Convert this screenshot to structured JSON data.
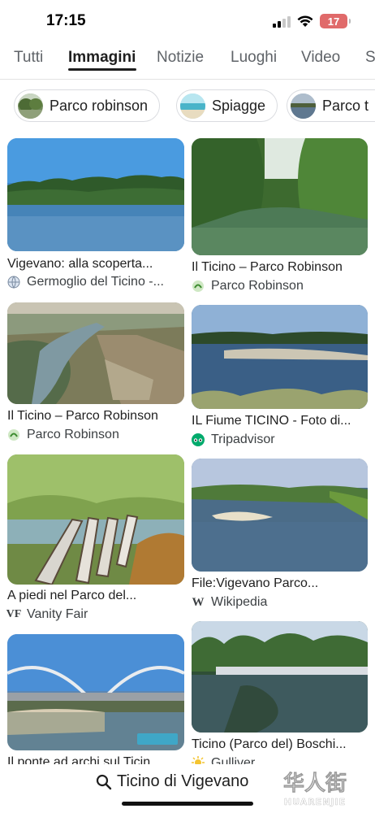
{
  "status_bar": {
    "time": "17:15",
    "battery": "17"
  },
  "tabs": [
    {
      "label": "Tutti",
      "active": false
    },
    {
      "label": "Immagini",
      "active": true
    },
    {
      "label": "Notizie",
      "active": false
    },
    {
      "label": "Luoghi",
      "active": false
    },
    {
      "label": "Video",
      "active": false
    },
    {
      "label": "S",
      "active": false
    }
  ],
  "chips": [
    {
      "label": "Parco robinson"
    },
    {
      "label": "Spiagge"
    },
    {
      "label": "Parco t"
    }
  ],
  "results": [
    {
      "title": "Vigevano: alla scoperta...",
      "source": "Germoglio del Ticino -..."
    },
    {
      "title": "Il Ticino – Parco Robinson",
      "source": "Parco Robinson"
    },
    {
      "title": "Il Ticino – Parco Robinson",
      "source": "Parco Robinson"
    },
    {
      "title": "IL Fiume TICINO - Foto di...",
      "source": "Tripadvisor"
    },
    {
      "title": "A piedi nel Parco del...",
      "source": "Vanity Fair",
      "source_badge": "VF"
    },
    {
      "title": "File:Vigevano Parco...",
      "source": "Wikipedia",
      "source_badge": "W"
    },
    {
      "title": "Il ponte ad archi sul Ticin...",
      "source": ""
    },
    {
      "title": "Ticino (Parco del) Boschi...",
      "source": "Gulliver"
    }
  ],
  "bottom": {
    "query": "Ticino di Vigevano"
  },
  "watermark": {
    "text": "华人街",
    "subtext": "HUARENJIE"
  }
}
